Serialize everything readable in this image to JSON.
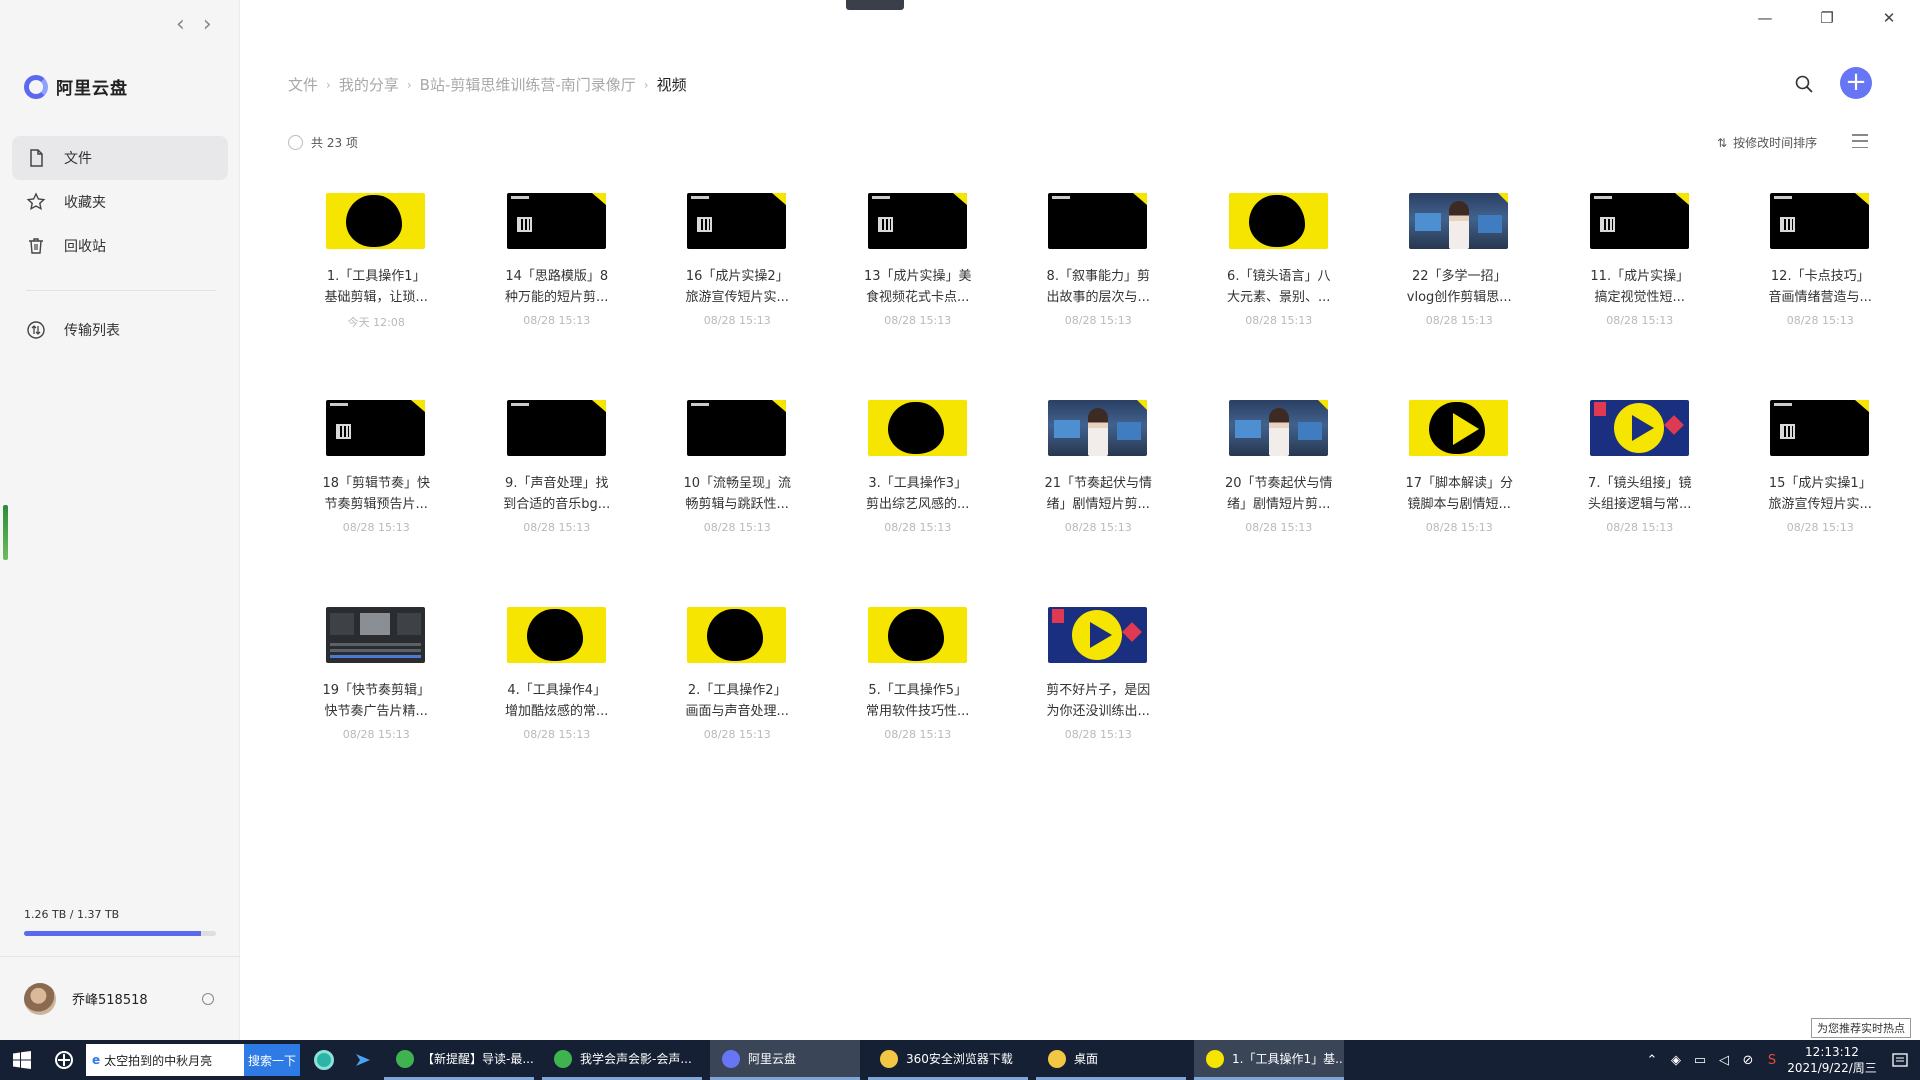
{
  "sidebar": {
    "app_name": "阿里云盘",
    "nav": [
      {
        "label": "文件",
        "icon": "file-icon",
        "active": true
      },
      {
        "label": "收藏夹",
        "icon": "star-icon",
        "active": false
      },
      {
        "label": "回收站",
        "icon": "trash-icon",
        "active": false
      }
    ],
    "transfer_label": "传输列表",
    "storage": {
      "text": "1.26 TB / 1.37 TB",
      "used_fraction": 0.92
    },
    "user": {
      "name": "乔峰518518"
    }
  },
  "header": {
    "breadcrumb": [
      "文件",
      "我的分享",
      "B站-剪辑思维训练营-南门录像厅",
      "视频"
    ]
  },
  "toolbar": {
    "count_label": "共 23 项",
    "sort_label": "按修改时间排序"
  },
  "files": [
    {
      "l1": "1.「工具操作1」",
      "l2": "基础剪辑，让琐...",
      "date": "今天 12:08",
      "thumb": "yellow"
    },
    {
      "l1": "14「思路模版」8",
      "l2": "种万能的短片剪...",
      "date": "08/28 15:13",
      "thumb": "black-qr"
    },
    {
      "l1": "16「成片实操2」",
      "l2": "旅游宣传短片实...",
      "date": "08/28 15:13",
      "thumb": "black-qr"
    },
    {
      "l1": "13「成片实操」美",
      "l2": "食视频花式卡点...",
      "date": "08/28 15:13",
      "thumb": "black-qr"
    },
    {
      "l1": "8.「叙事能力」剪",
      "l2": "出故事的层次与...",
      "date": "08/28 15:13",
      "thumb": "black"
    },
    {
      "l1": "6.「镜头语言」八",
      "l2": "大元素、景别、...",
      "date": "08/28 15:13",
      "thumb": "yellow"
    },
    {
      "l1": "22「多学一招」",
      "l2": "vlog创作剪辑思...",
      "date": "08/28 15:13",
      "thumb": "photo"
    },
    {
      "l1": "11.「成片实操」",
      "l2": "搞定视觉性短...",
      "date": "08/28 15:13",
      "thumb": "black-qr"
    },
    {
      "l1": "12.「卡点技巧」",
      "l2": "音画情绪营造与...",
      "date": "08/28 15:13",
      "thumb": "black-qr"
    },
    {
      "l1": "18「剪辑节奏」快",
      "l2": "节奏剪辑预告片...",
      "date": "08/28 15:13",
      "thumb": "black-qr"
    },
    {
      "l1": "9.「声音处理」找",
      "l2": "到合适的音乐bg...",
      "date": "08/28 15:13",
      "thumb": "black"
    },
    {
      "l1": "10「流畅呈现」流",
      "l2": "畅剪辑与跳跃性...",
      "date": "08/28 15:13",
      "thumb": "black"
    },
    {
      "l1": "3.「工具操作3」",
      "l2": "剪出综艺风感的...",
      "date": "08/28 15:13",
      "thumb": "yellow"
    },
    {
      "l1": "21「节奏起伏与情",
      "l2": "绪」剧情短片剪...",
      "date": "08/28 15:13",
      "thumb": "photo"
    },
    {
      "l1": "20「节奏起伏与情",
      "l2": "绪」剧情短片剪...",
      "date": "08/28 15:13",
      "thumb": "photo"
    },
    {
      "l1": "17「脚本解读」分",
      "l2": "镜脚本与剧情短...",
      "date": "08/28 15:13",
      "thumb": "yellow-qr"
    },
    {
      "l1": "7.「镜头组接」镜",
      "l2": "头组接逻辑与常...",
      "date": "08/28 15:13",
      "thumb": "promo"
    },
    {
      "l1": "15「成片实操1」",
      "l2": "旅游宣传短片实...",
      "date": "08/28 15:13",
      "thumb": "black-qr"
    },
    {
      "l1": "19「快节奏剪辑」",
      "l2": "快节奏广告片精...",
      "date": "08/28 15:13",
      "thumb": "editor"
    },
    {
      "l1": "4.「工具操作4」",
      "l2": "增加酷炫感的常...",
      "date": "08/28 15:13",
      "thumb": "yellow"
    },
    {
      "l1": "2.「工具操作2」",
      "l2": "画面与声音处理...",
      "date": "08/28 15:13",
      "thumb": "yellow"
    },
    {
      "l1": "5.「工具操作5」",
      "l2": "常用软件技巧性...",
      "date": "08/28 15:13",
      "thumb": "yellow"
    },
    {
      "l1": "剪不好片子，是因",
      "l2": "为你还没训练出...",
      "date": "08/28 15:13",
      "thumb": "promo"
    }
  ],
  "tooltip": "为您推荐实时热点",
  "taskbar": {
    "search_text": "太空拍到的中秋月亮",
    "search_button": "搜索一下",
    "tasks": [
      {
        "label": "【新提醒】导读-最...",
        "color": "#3fb34f",
        "width": 150,
        "active": false
      },
      {
        "label": "我学会声会影-会声...",
        "color": "#3fb34f",
        "width": 160,
        "active": false
      },
      {
        "label": "阿里云盘",
        "color": "#6676f4",
        "width": 150,
        "active": true
      },
      {
        "label": "360安全浏览器下载",
        "color": "#f2c744",
        "width": 160,
        "active": false
      },
      {
        "label": "桌面",
        "color": "#f2c744",
        "width": 150,
        "active": false
      },
      {
        "label": "1.「工具操作1」基...",
        "color": "#f6e500",
        "width": 150,
        "active": true
      }
    ],
    "time": "12:13:12",
    "date": "2021/9/22/周三"
  }
}
